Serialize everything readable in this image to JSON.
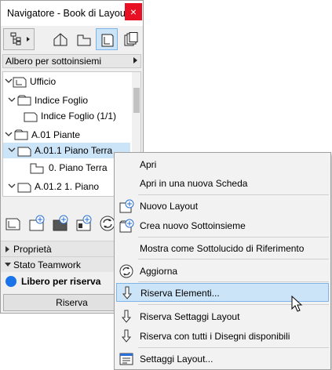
{
  "window": {
    "title": "Navigatore - Book di Layout",
    "close_glyph": "×",
    "view_dropdown": "Albero per sottoinsiemi"
  },
  "tree": {
    "items": [
      {
        "label": "Ufficio"
      },
      {
        "label": "Indice Foglio"
      },
      {
        "label": "Indice Foglio (1/1)"
      },
      {
        "label": "A.01 Piante"
      },
      {
        "label": "A.01.1 Piano Terra"
      },
      {
        "label": "0. Piano Terra"
      },
      {
        "label": "A.01.2 1. Piano"
      }
    ]
  },
  "sections": {
    "properties": "Proprietà",
    "teamwork": "Stato Teamwork"
  },
  "status": {
    "text": "Libero per riserva",
    "color": "#1a73e8"
  },
  "reserve_button": "Riserva",
  "context_menu": {
    "items": [
      {
        "label": "Apri"
      },
      {
        "label": "Apri in una nuova Scheda"
      },
      {
        "label": "Nuovo Layout"
      },
      {
        "label": "Crea nuovo Sottoinsieme"
      },
      {
        "label": "Mostra come Sottolucido di Riferimento"
      },
      {
        "label": "Aggiorna"
      },
      {
        "label": "Riserva Elementi..."
      },
      {
        "label": "Riserva Settaggi Layout"
      },
      {
        "label": "Riserva con tutti i Disegni disponibili"
      },
      {
        "label": "Settaggi Layout..."
      }
    ],
    "highlighted": "Riserva Elementi..."
  },
  "colors": {
    "selection": "#cce4f7",
    "selection_border": "#7eb4ea",
    "close_button": "#e81123"
  }
}
